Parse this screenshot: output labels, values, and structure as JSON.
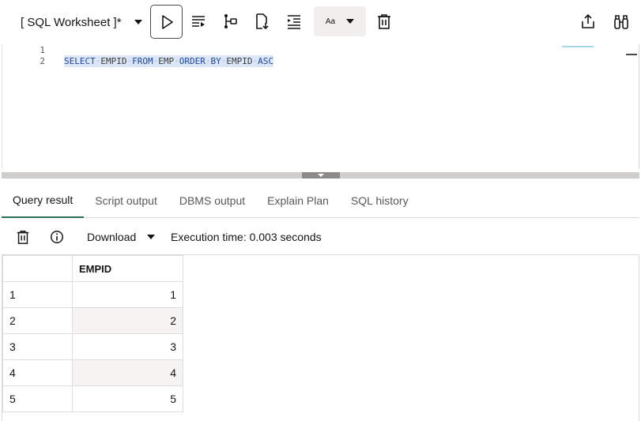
{
  "toolbar": {
    "worksheet_title": "[ SQL Worksheet ]*",
    "run_icon": "run-statement-icon",
    "run_script_icon": "run-script-icon",
    "explain_icon": "explain-plan-icon",
    "autotrace_icon": "autotrace-icon",
    "format_icon": "format-indent-icon",
    "case_label": "Aa",
    "clear_icon": "trash-icon",
    "share_icon": "share-icon",
    "find_icon": "binoculars-icon"
  },
  "editor": {
    "line_numbers": [
      "1",
      "2"
    ],
    "code": [
      "SELECT",
      "EMPID",
      "FROM",
      "EMP",
      "ORDER",
      "BY",
      "EMPID",
      "ASC"
    ]
  },
  "tabs": [
    {
      "label": "Query result",
      "active": true
    },
    {
      "label": "Script output",
      "active": false
    },
    {
      "label": "DBMS output",
      "active": false
    },
    {
      "label": "Explain Plan",
      "active": false
    },
    {
      "label": "SQL history",
      "active": false
    }
  ],
  "result_toolbar": {
    "clear_icon": "trash-icon",
    "info_icon": "info-icon",
    "download_label": "Download",
    "execution_time": "Execution time: 0.003 seconds"
  },
  "grid": {
    "columns": [
      "EMPID"
    ],
    "rows": [
      {
        "num": "1",
        "EMPID": "1"
      },
      {
        "num": "2",
        "EMPID": "2"
      },
      {
        "num": "3",
        "EMPID": "3"
      },
      {
        "num": "4",
        "EMPID": "4"
      },
      {
        "num": "5",
        "EMPID": "5"
      }
    ]
  }
}
